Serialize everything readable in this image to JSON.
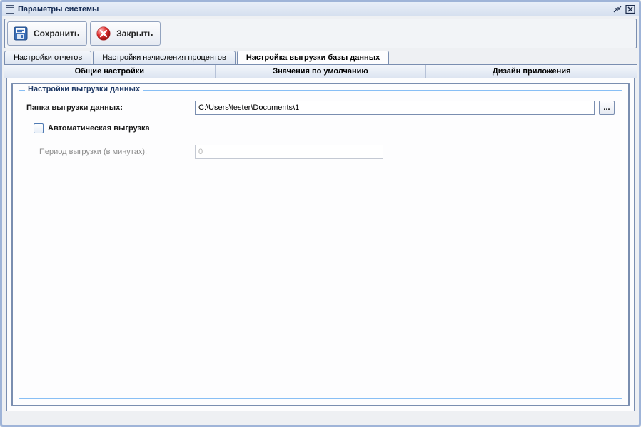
{
  "window": {
    "title": "Параметры системы"
  },
  "toolbar": {
    "save_label": "Сохранить",
    "close_label": "Закрыть"
  },
  "tabs_row1": [
    {
      "label": "Настройки отчетов",
      "active": false
    },
    {
      "label": "Настройки начисления процентов",
      "active": false
    },
    {
      "label": "Настройка выгрузки базы данных",
      "active": true
    }
  ],
  "tabs_row2": [
    {
      "label": "Общие настройки"
    },
    {
      "label": "Значения по умолчанию"
    },
    {
      "label": "Дизайн приложения"
    }
  ],
  "group": {
    "legend": "Настройки выгрузки данных",
    "folder_label": "Папка выгрузки данных:",
    "folder_value": "C:\\Users\\tester\\Documents\\1",
    "browse_label": "...",
    "auto_checkbox_label": "Автоматическая выгрузка",
    "auto_checked": false,
    "period_label": "Период выгрузки (в минутах):",
    "period_value": "0"
  }
}
